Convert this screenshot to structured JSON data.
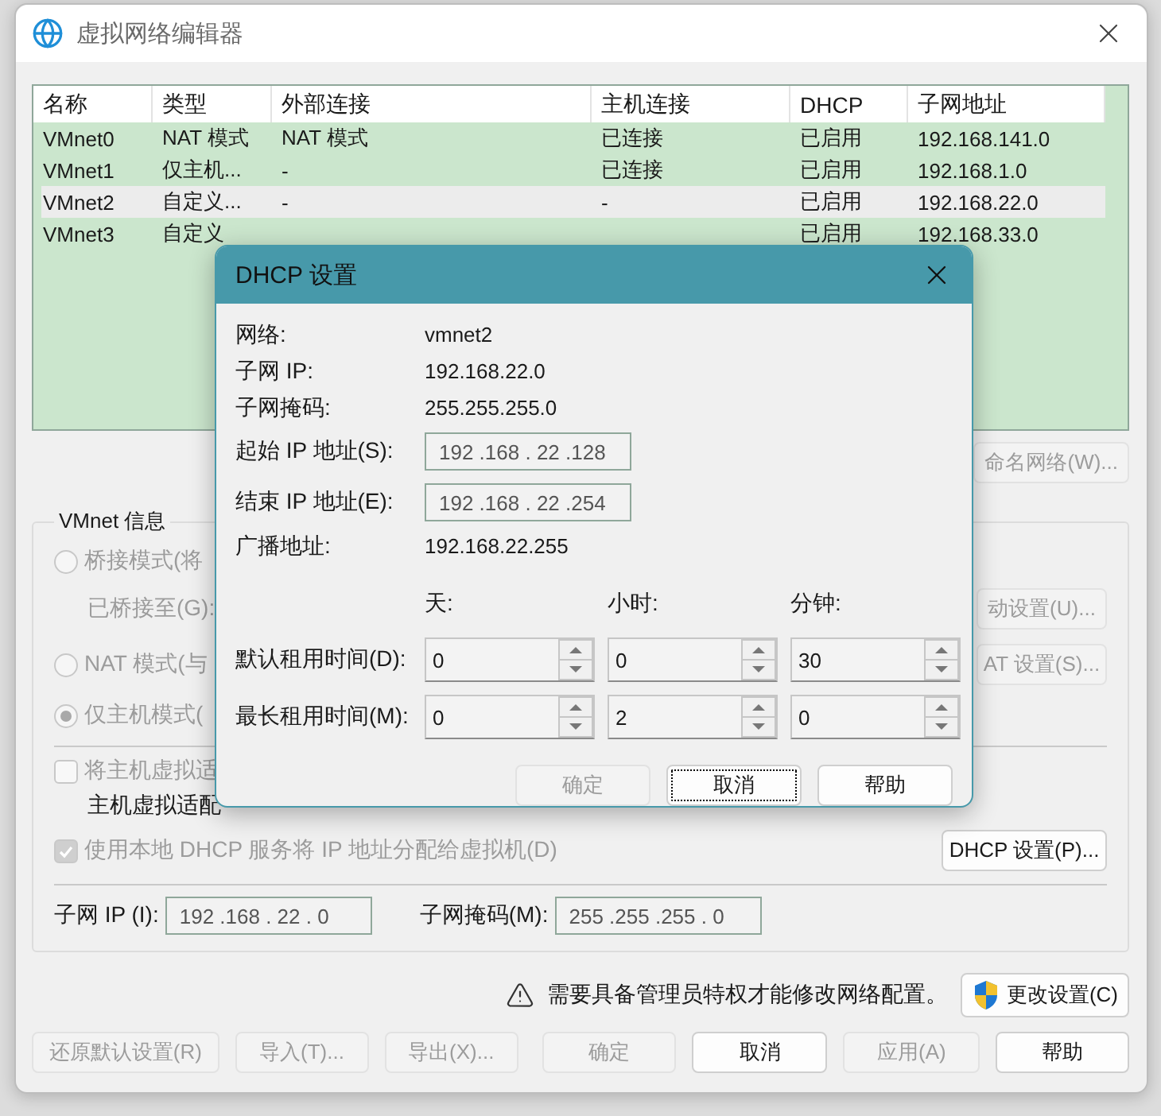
{
  "window": {
    "title": "虚拟网络编辑器"
  },
  "table": {
    "columns": [
      "名称",
      "类型",
      "外部连接",
      "主机连接",
      "DHCP",
      "子网地址"
    ],
    "rows": [
      {
        "cells": [
          "VMnet0",
          "NAT 模式",
          "NAT 模式",
          "已连接",
          "已启用",
          "192.168.141.0"
        ],
        "selected": false
      },
      {
        "cells": [
          "VMnet1",
          "仅主机...",
          "-",
          "已连接",
          "已启用",
          "192.168.1.0"
        ],
        "selected": false
      },
      {
        "cells": [
          "VMnet2",
          "自定义...",
          "-",
          "-",
          "已启用",
          "192.168.22.0"
        ],
        "selected": true
      },
      {
        "cells": [
          "VMnet3",
          "自定义",
          "",
          "",
          "已启用",
          "192.168.33.0"
        ],
        "selected": false
      }
    ]
  },
  "rename_button": "命名网络(W)...",
  "vmnet_info": {
    "title": "VMnet 信息",
    "modes": [
      {
        "label": "桥接模式(将",
        "selected": false
      },
      {
        "label": "NAT 模式(与",
        "selected": false
      },
      {
        "label": "仅主机模式(",
        "selected": true
      }
    ],
    "bridged_to": "已桥接至(G):",
    "auto_button": "动设置(U)...",
    "nat_button": "AT 设置(S)...",
    "connect_adapter": {
      "label": "将主机虚拟适",
      "checked": false
    },
    "adapter_name": "主机虚拟适配",
    "use_dhcp": {
      "label": "使用本地 DHCP 服务将 IP 地址分配给虚拟机(D)",
      "checked": true
    },
    "dhcp_button": "DHCP 设置(P)...",
    "subnet_ip": {
      "label": "子网 IP (I):",
      "value": "192 .168 . 22 . 0"
    },
    "subnet_mask": {
      "label": "子网掩码(M):",
      "value": "255 .255 .255 . 0"
    }
  },
  "notice": {
    "text": "需要具备管理员特权才能修改网络配置。",
    "button": "更改设置(C)"
  },
  "buttons": [
    {
      "label": "还原默认设置(R)",
      "disabled": true
    },
    {
      "label": "导入(T)...",
      "disabled": true
    },
    {
      "label": "导出(X)...",
      "disabled": true
    },
    {
      "label": "确定",
      "disabled": true
    },
    {
      "label": "取消",
      "disabled": false
    },
    {
      "label": "应用(A)",
      "disabled": true
    },
    {
      "label": "帮助",
      "disabled": false
    }
  ],
  "dialog": {
    "title": "DHCP 设置",
    "details": [
      {
        "label": "网络:",
        "value": "vmnet2",
        "kind": "text"
      },
      {
        "label": "子网 IP:",
        "value": "192.168.22.0",
        "kind": "text"
      },
      {
        "label": "子网掩码:",
        "value": "255.255.255.0",
        "kind": "text"
      },
      {
        "label": "起始 IP 地址(S):",
        "value": "192 .168 . 22 .128",
        "kind": "field"
      },
      {
        "label": "结束 IP 地址(E):",
        "value": "192 .168 . 22 .254",
        "kind": "field"
      },
      {
        "label": "广播地址:",
        "value": "192.168.22.255",
        "kind": "text"
      }
    ],
    "lease_units": [
      "天:",
      "小时:",
      "分钟:"
    ],
    "leases": [
      {
        "label": "默认租用时间(D):",
        "values": [
          "0",
          "0",
          "30"
        ]
      },
      {
        "label": "最长租用时间(M):",
        "values": [
          "0",
          "2",
          "0"
        ]
      }
    ],
    "buttons": [
      {
        "label": "确定",
        "disabled": true,
        "focused": false
      },
      {
        "label": "取消",
        "disabled": false,
        "focused": true
      },
      {
        "label": "帮助",
        "disabled": false,
        "focused": false
      }
    ]
  }
}
